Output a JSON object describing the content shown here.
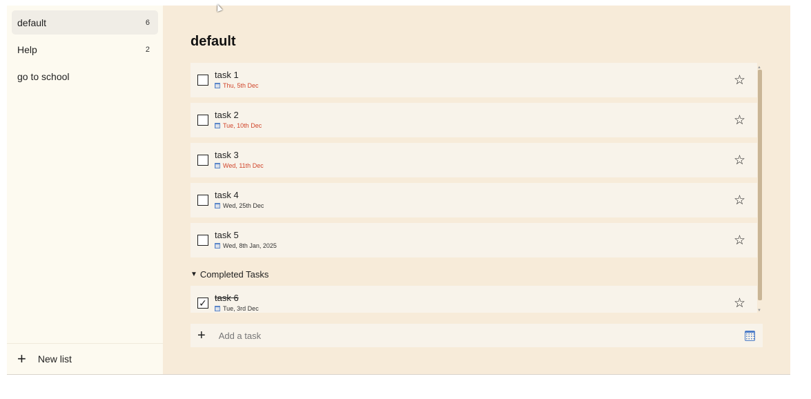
{
  "sidebar": {
    "lists": [
      {
        "label": "default",
        "count": "6",
        "active": true
      },
      {
        "label": "Help",
        "count": "2",
        "active": false
      },
      {
        "label": "go to school",
        "count": "",
        "active": false
      }
    ],
    "new_list_icon": "plus-icon",
    "new_list_label": "New list"
  },
  "main": {
    "title": "default",
    "tasks": [
      {
        "name": "task 1",
        "date": "Thu, 5th Dec",
        "overdue": true,
        "done": false
      },
      {
        "name": "task 2",
        "date": "Tue, 10th Dec",
        "overdue": true,
        "done": false
      },
      {
        "name": "task 3",
        "date": "Wed, 11th Dec",
        "overdue": true,
        "done": false
      },
      {
        "name": "task 4",
        "date": "Wed, 25th Dec",
        "overdue": false,
        "done": false
      },
      {
        "name": "task 5",
        "date": "Wed, 8th Jan, 2025",
        "overdue": false,
        "done": false
      }
    ],
    "completed_header": "Completed Tasks",
    "completed_tasks": [
      {
        "name": "task 6",
        "date": "Tue, 3rd Dec",
        "overdue": false,
        "done": true
      }
    ],
    "add_task": {
      "placeholder": "Add a task",
      "icon": "calendar-icon"
    }
  },
  "colors": {
    "sidebar_bg": "#fdfaf0",
    "main_bg": "#f7ebd9",
    "task_bg": "#f8f3ea",
    "overdue": "#d0452b",
    "scroll_thumb": "#c9b596",
    "calendar_accent": "#4c7cc8"
  },
  "icons": {
    "star": "star-outline-icon",
    "checkbox_checked": "check-icon",
    "date": "calendar-mini-icon",
    "collapse": "triangle-down-icon"
  }
}
